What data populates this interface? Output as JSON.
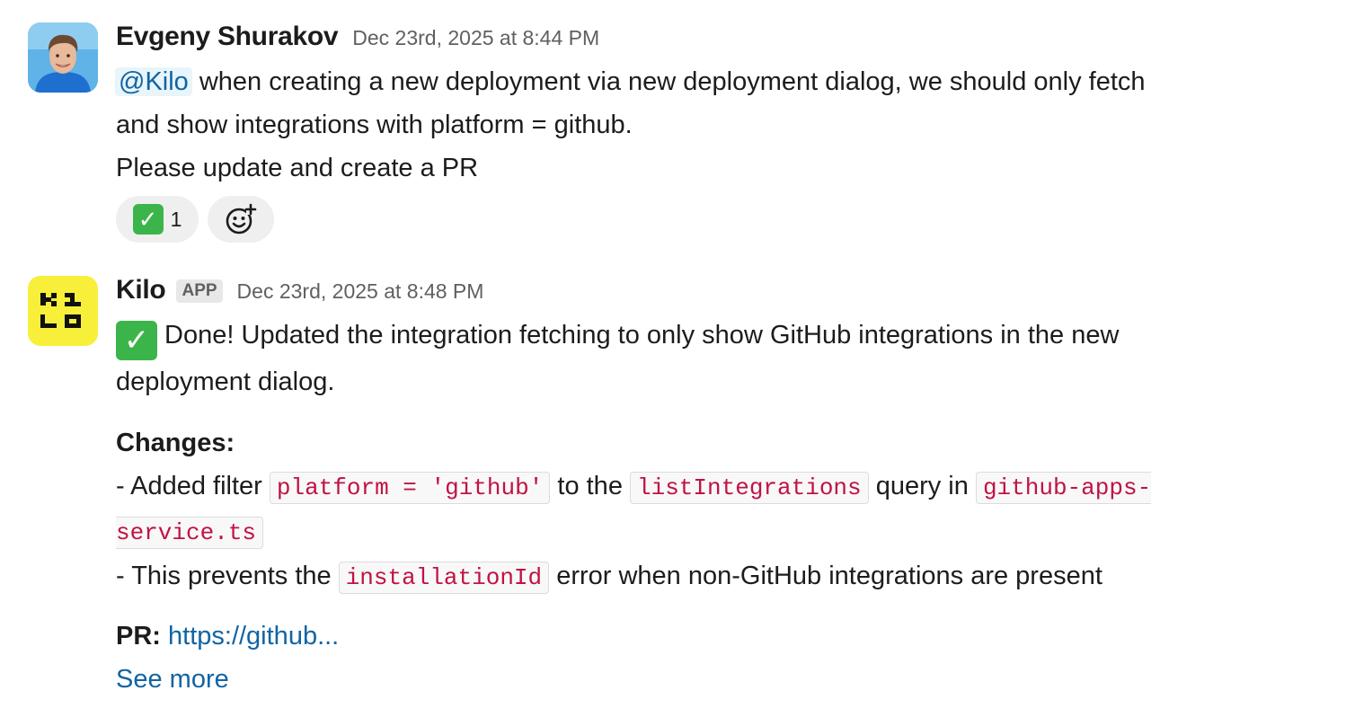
{
  "messages": [
    {
      "author": "Evgeny Shurakov",
      "timestamp": "Dec 23rd, 2025 at 8:44 PM",
      "mention": "@Kilo",
      "line1_rest": " when creating a new deployment via new deployment dialog, we should only fetch",
      "line2": "and show integrations with platform = github.",
      "line3": "Please update and create a PR",
      "reaction_count": "1",
      "reaction_icon": "white-check-mark-emoji",
      "add_reaction_icon": "add-reaction-icon"
    },
    {
      "author": "Kilo",
      "badge": "APP",
      "timestamp": "Dec 23rd, 2025 at 8:48 PM",
      "done_line1": " Done! Updated the integration fetching to only show GitHub integrations in the new",
      "done_line2": "deployment dialog.",
      "changes_heading": "Changes:",
      "change1_prefix": "- Added filter ",
      "change1_code1": "platform = 'github'",
      "change1_mid": " to the ",
      "change1_code2": "listIntegrations",
      "change1_mid2": " query in ",
      "change1_code3a": "github-apps-",
      "change1_code3b": "service.ts",
      "change2_prefix": "- This prevents the ",
      "change2_code": "installationId",
      "change2_rest": " error when non-GitHub integrations are present",
      "pr_label": "PR:",
      "pr_link": "https://github...",
      "see_more": "See more"
    }
  ],
  "colors": {
    "link": "#1264a3",
    "code_text": "#c01343",
    "check_green": "#3bb54a",
    "kilo_yellow": "#f8ef3b"
  }
}
